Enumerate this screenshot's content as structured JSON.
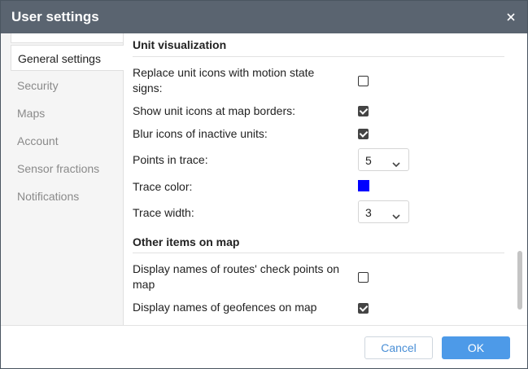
{
  "dialog": {
    "title": "User settings",
    "close_icon": "close-icon"
  },
  "sidebar": {
    "items": [
      {
        "label": "General settings",
        "active": true
      },
      {
        "label": "Security",
        "active": false
      },
      {
        "label": "Maps",
        "active": false
      },
      {
        "label": "Account",
        "active": false
      },
      {
        "label": "Sensor fractions",
        "active": false
      },
      {
        "label": "Notifications",
        "active": false
      }
    ]
  },
  "sections": {
    "unit_visualization": {
      "title": "Unit visualization",
      "replace_icons": {
        "label": "Replace unit icons with motion state signs:",
        "checked": false
      },
      "show_borders": {
        "label": "Show unit icons at map borders:",
        "checked": true
      },
      "blur_inactive": {
        "label": "Blur icons of inactive units:",
        "checked": true
      },
      "points_in_trace": {
        "label": "Points in trace:",
        "value": "5"
      },
      "trace_color": {
        "label": "Trace color:",
        "color": "#0000ff"
      },
      "trace_width": {
        "label": "Trace width:",
        "value": "3"
      }
    },
    "other_items": {
      "title": "Other items on map",
      "route_check_points": {
        "label": "Display names of routes' check points on map",
        "checked": false
      },
      "geofence_names": {
        "label": "Display names of geofences on map",
        "checked": true
      }
    }
  },
  "footer": {
    "cancel_label": "Cancel",
    "ok_label": "OK"
  },
  "colors": {
    "titlebar": "#5a6470",
    "accent": "#4d9ae8"
  }
}
